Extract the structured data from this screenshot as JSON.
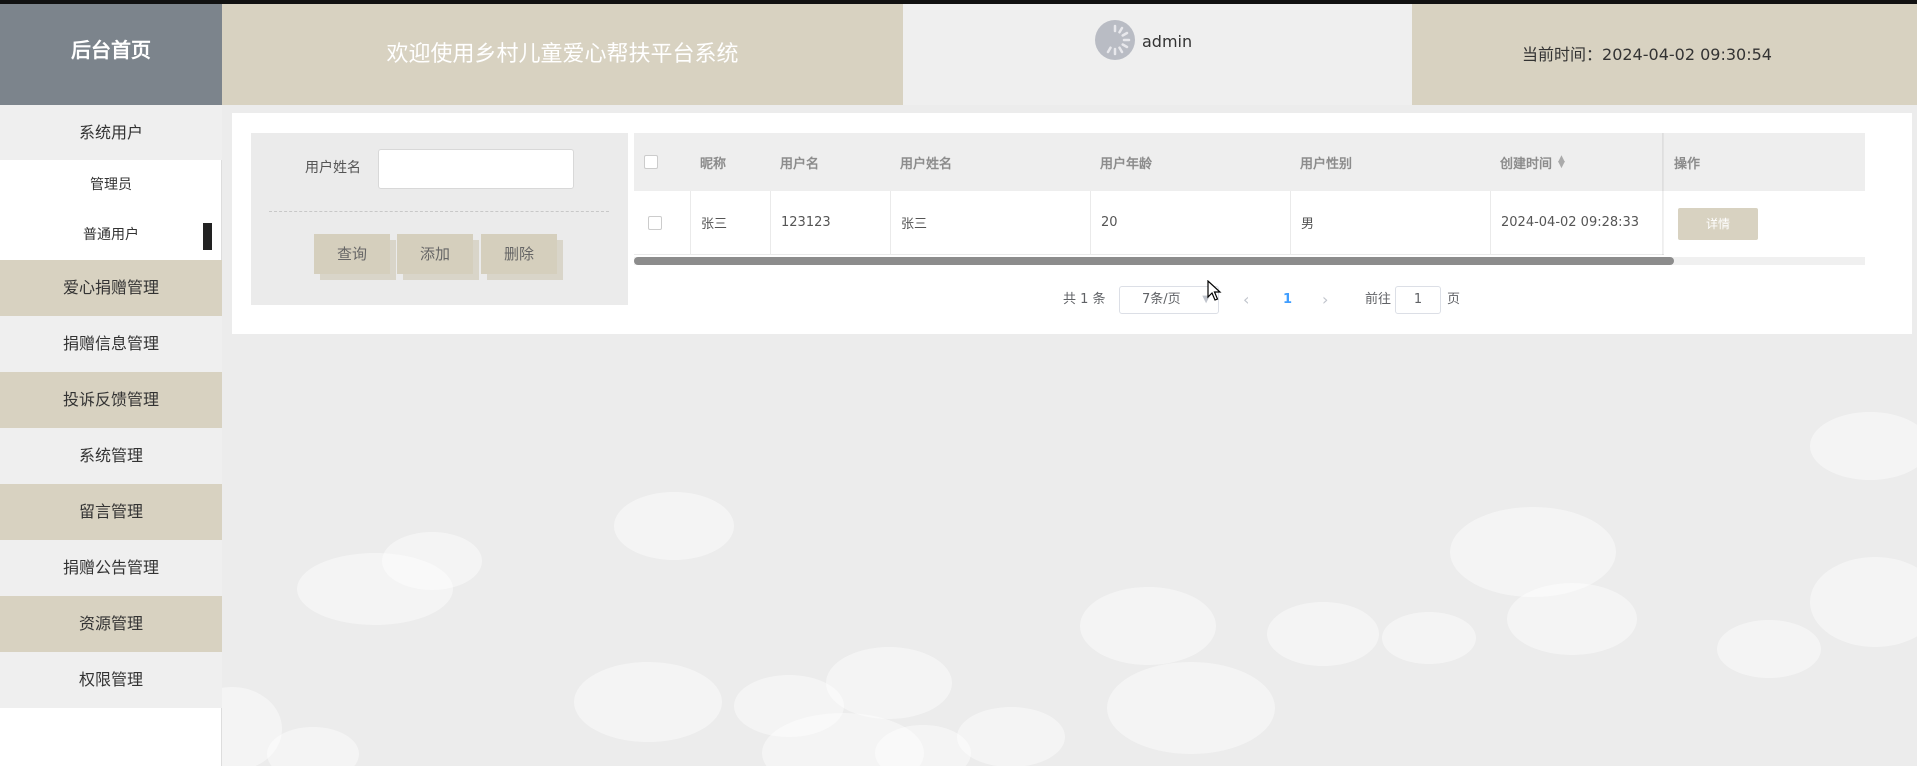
{
  "header": {
    "home_label": "后台首页",
    "system_title": "欢迎使用乡村儿童爱心帮扶平台系统",
    "username": "admin",
    "time_label": "当前时间：",
    "time_value": "2024-04-02 09:30:54"
  },
  "sidebar": {
    "items": [
      {
        "label": "系统用户"
      },
      {
        "label": "管理员"
      },
      {
        "label": "普通用户"
      },
      {
        "label": "爱心捐赠管理"
      },
      {
        "label": "捐赠信息管理"
      },
      {
        "label": "投诉反馈管理"
      },
      {
        "label": "系统管理"
      },
      {
        "label": "留言管理"
      },
      {
        "label": "捐赠公告管理"
      },
      {
        "label": "资源管理"
      },
      {
        "label": "权限管理"
      }
    ]
  },
  "search": {
    "label": "用户姓名",
    "value": "",
    "query_label": "查询",
    "add_label": "添加",
    "delete_label": "删除"
  },
  "table": {
    "columns": [
      "昵称",
      "用户名",
      "用户姓名",
      "用户年龄",
      "用户性别",
      "创建时间",
      "操作"
    ],
    "rows": [
      {
        "nickname": "张三",
        "username": "123123",
        "name": "张三",
        "age": "20",
        "gender": "男",
        "created": "2024-04-02 09:28:33",
        "action": "详情"
      }
    ]
  },
  "pagination": {
    "total_text": "共 1 条",
    "page_size": "7条/页",
    "prev_icon": "‹",
    "current_page": "1",
    "next_icon": "›",
    "goto_label": "前往",
    "goto_value": "1",
    "page_suffix": "页"
  }
}
